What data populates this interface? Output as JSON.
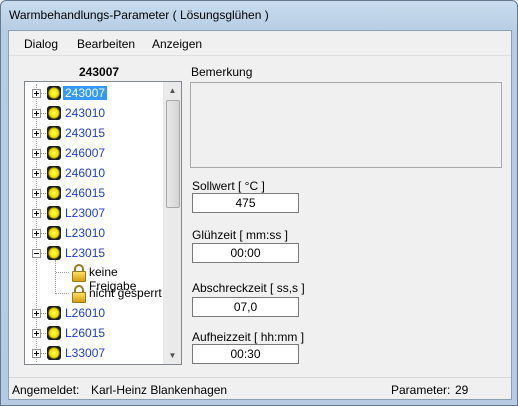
{
  "window": {
    "title": "Warmbehandlungs-Parameter ( Lösungsglühen )"
  },
  "menu": [
    "Dialog",
    "Bearbeiten",
    "Anzeigen"
  ],
  "tree": {
    "heading": "243007",
    "items": [
      {
        "label": "243007",
        "selected": true
      },
      {
        "label": "243010"
      },
      {
        "label": "243015"
      },
      {
        "label": "246007"
      },
      {
        "label": "246010"
      },
      {
        "label": "246015"
      },
      {
        "label": "L23007"
      },
      {
        "label": "L23010"
      },
      {
        "label": "L23015",
        "expanded": true
      },
      {
        "label": "L26010"
      },
      {
        "label": "L26015"
      },
      {
        "label": "L33007"
      }
    ],
    "children": [
      {
        "label": "keine Freigabe",
        "icon": "lock-icon"
      },
      {
        "label": "nicht gesperrt",
        "icon": "lock-icon"
      }
    ]
  },
  "form": {
    "remark_label": "Bemerkung",
    "sollwert_label": "Sollwert [ °C ]",
    "sollwert_value": "475",
    "gluehzeit_label": "Glühzeit [ mm:ss ]",
    "gluehzeit_value": "00:00",
    "abschreckzeit_label": "Abschreckzeit [ ss,s ]",
    "abschreckzeit_value": "07,0",
    "aufheizzeit_label": "Aufheizzeit [ hh:mm ]",
    "aufheizzeit_value": "00:30"
  },
  "status": {
    "logged_in_label": "Angemeldet:",
    "user": "Karl-Heinz Blankenhagen",
    "param_label": "Parameter:",
    "param_count": "29"
  },
  "colors": {
    "link": "#1c3fd0",
    "selection": "#3399ff",
    "titlebar": "#c9dcef"
  }
}
